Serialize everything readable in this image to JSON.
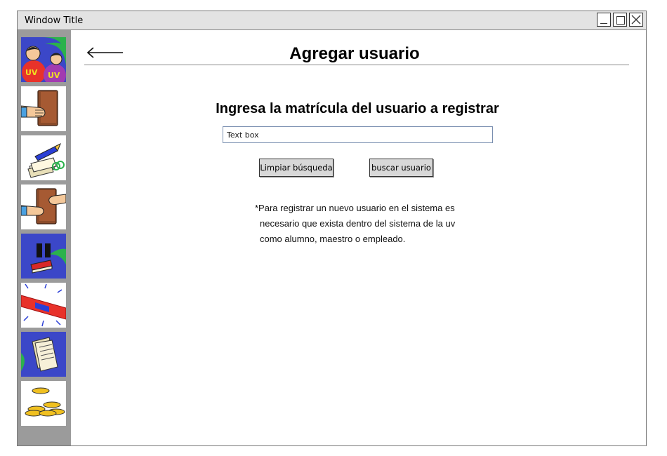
{
  "window": {
    "title": "Window Title",
    "controls": [
      "minimize-icon",
      "maximize-icon",
      "close-icon"
    ]
  },
  "sidebar": {
    "items": [
      {
        "name": "users",
        "icon": "users-uv-icon"
      },
      {
        "name": "book-return",
        "icon": "hand-book-icon"
      },
      {
        "name": "catalog",
        "icon": "papers-pencil-icon"
      },
      {
        "name": "loans",
        "icon": "book-exchange-icon"
      },
      {
        "name": "pause",
        "icon": "pause-book-icon"
      },
      {
        "name": "alerts",
        "icon": "siren-icon"
      },
      {
        "name": "documents",
        "icon": "documents-icon"
      },
      {
        "name": "fines",
        "icon": "coins-icon"
      }
    ]
  },
  "header": {
    "back_icon": "back-arrow-icon",
    "title": "Agregar usuario"
  },
  "form": {
    "prompt": "Ingresa la matrícula del usuario a registrar",
    "textbox_value": "Text box",
    "clear_button": "Limpiar búsqueda",
    "search_button": "buscar usuario"
  },
  "note": {
    "line1": "*Para registrar un nuevo usuario en el sistema es",
    "line2": "necesario que exista dentro del sistema de la uv",
    "line3": "como alumno, maestro o empleado."
  },
  "colors": {
    "sidebar_bg": "#9b9b9b",
    "titlebar_bg": "#e3e3e3",
    "button_bg": "#d8d8d8",
    "icon_blue": "#3b47c8",
    "icon_green": "#2bb24c"
  }
}
